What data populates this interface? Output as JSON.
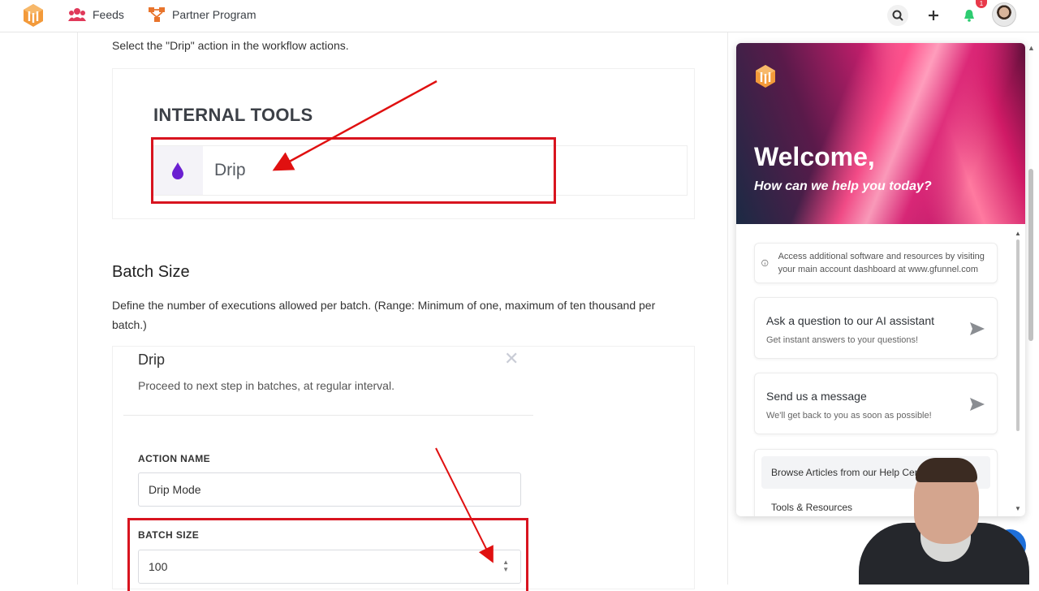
{
  "nav": {
    "feeds_label": "Feeds",
    "partner_label": "Partner Program",
    "notification_count": "1",
    "accent_color": "#e8742c"
  },
  "article": {
    "intro": "Select the \"Drip\" action in the workflow actions.",
    "shot1": {
      "section_heading": "INTERNAL TOOLS",
      "item_label": "Drip"
    },
    "batch_heading": "Batch Size",
    "batch_description": "Define the number of executions allowed per batch. (Range: Minimum of one, maximum of ten thousand per batch.)",
    "shot2": {
      "panel_title": "Drip",
      "panel_subtitle": "Proceed to next step in batches, at regular interval.",
      "close_symbol": "✕",
      "action_name_label": "ACTION NAME",
      "action_name_value": "Drip Mode",
      "batch_size_label": "BATCH SIZE",
      "batch_size_value": "100"
    },
    "highlight_color": "#d8141f"
  },
  "help_widget": {
    "welcome": "Welcome,",
    "subtitle": "How can we help you today?",
    "info_text": "Access additional software and resources by visiting your main account dashboard at www.gfunnel.com",
    "ai_card": {
      "title": "Ask a question to our AI assistant",
      "subtitle": "Get instant answers to your questions!"
    },
    "message_card": {
      "title": "Send us a message",
      "subtitle": "We'll get back to you as soon as possible!"
    },
    "links": [
      "Browse Articles from our Help Center",
      "Tools & Resources"
    ]
  }
}
